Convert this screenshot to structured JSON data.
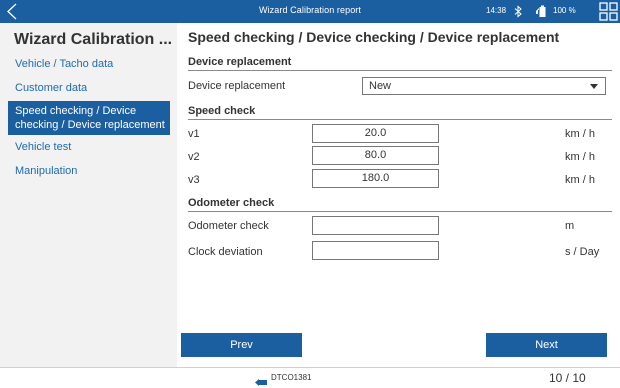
{
  "statusbar": {
    "title": "Wizard Calibration report",
    "time": "14:38",
    "battery_percent": "100 %",
    "icons": [
      "back-arrow-icon",
      "bluetooth-icon",
      "battery-icon",
      "grid-menu-icon"
    ]
  },
  "sidebar": {
    "title": "Wizard Calibration ...",
    "items": [
      {
        "label": "Vehicle / Tacho data",
        "active": false
      },
      {
        "label": "Customer data",
        "active": false
      },
      {
        "label": "Speed checking / Device checking / Device replacement",
        "active": true
      },
      {
        "label": "Vehicle test",
        "active": false
      },
      {
        "label": "Manipulation",
        "active": false
      }
    ]
  },
  "main": {
    "title": "Speed checking / Device checking / Device replacement",
    "device_replacement": {
      "heading": "Device replacement",
      "label": "Device replacement",
      "value": "New"
    },
    "speed_check": {
      "heading": "Speed check",
      "rows": [
        {
          "label": "v1",
          "value": "20.0",
          "unit": "km / h"
        },
        {
          "label": "v2",
          "value": "80.0",
          "unit": "km / h"
        },
        {
          "label": "v3",
          "value": "180.0",
          "unit": "km / h"
        }
      ]
    },
    "odometer_check": {
      "heading": "Odometer check",
      "rows": [
        {
          "label": "Odometer check",
          "value": "",
          "unit": "m"
        },
        {
          "label": "Clock deviation",
          "value": "",
          "unit": "s / Day"
        }
      ]
    },
    "buttons": {
      "prev": "Prev",
      "next": "Next"
    }
  },
  "bottombar": {
    "device": "DTCO1381",
    "pager": "10 / 10"
  },
  "colors": {
    "accent": "#1b5fa0",
    "sidebar_bg": "#f2f2f2",
    "link": "#1e6bb0"
  }
}
